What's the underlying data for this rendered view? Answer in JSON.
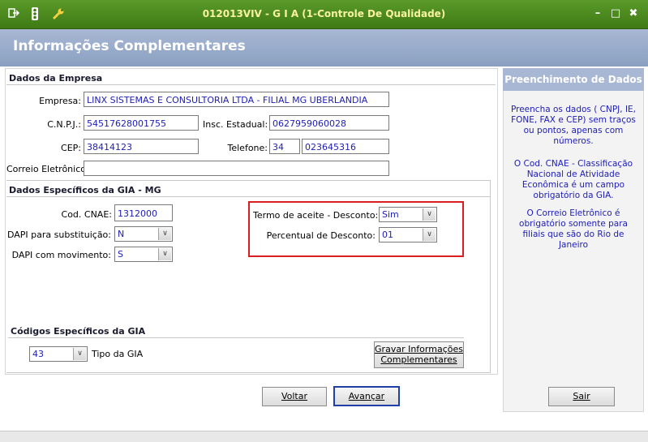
{
  "window": {
    "title": "012013VIV - G I A (1-Controle De Qualidade)",
    "minimize": "–",
    "maximize": "□",
    "close": "✖"
  },
  "header": {
    "title": "Informações Complementares"
  },
  "empresa_section": {
    "title": "Dados da Empresa",
    "empresa_label": "Empresa:",
    "empresa_value": "LINX SISTEMAS E CONSULTORIA LTDA - FILIAL MG UBERLANDIA",
    "cnpj_label": "C.N.P.J.:",
    "cnpj_value": "54517628001755",
    "insc_label": "Insc. Estadual:",
    "insc_value": "0627959060028",
    "cep_label": "CEP:",
    "cep_value": "38414123",
    "telefone_label": "Telefone:",
    "telefone_ddd": "34",
    "telefone_numero": "023645316",
    "email_label": "Correio Eletrônico:",
    "email_value": ""
  },
  "gia_section": {
    "title": "Dados Específicos da GIA - MG",
    "cnae_label": "Cod. CNAE:",
    "cnae_value": "1312000",
    "dapi_sub_label": "DAPI para substituição:",
    "dapi_sub_value": "N",
    "dapi_mov_label": "DAPI com movimento:",
    "dapi_mov_value": "S",
    "termo_label": "Termo de aceite - Desconto:",
    "termo_value": "Sim",
    "percentual_label": "Percentual de Desconto:",
    "percentual_value": "01"
  },
  "codigos_section": {
    "title": "Códigos Específicos da GIA",
    "tipo_value": "43",
    "tipo_label": "Tipo da GIA",
    "gravar_button": "Gravar Informações Complementares"
  },
  "footer": {
    "voltar_button": "Voltar",
    "avancar_button": "Avançar",
    "sair_button": "Sair"
  },
  "side_panel": {
    "title": "Preenchimento de Dados",
    "paragraph1": "Preencha os dados ( CNPJ, IE, FONE, FAX e CEP) sem traços ou pontos, apenas com números.",
    "paragraph2": "O Cod. CNAE - Classificação Nacional de Atividade Econômica é um campo obrigatório da GIA.",
    "paragraph3": "O Correio Eletrônico é obrigatório somente para filiais que são do Rio de Janeiro"
  },
  "colors": {
    "titlebar": "#4a8a20",
    "title_text": "#f8f2a0",
    "header_bg": "#a8b8d4",
    "field_text": "#1c1cb8",
    "highlight": "#d81e1e"
  },
  "icons": [
    "exit-icon",
    "traffic-light-icon",
    "wrench-icon",
    "chevron-down-icon"
  ]
}
